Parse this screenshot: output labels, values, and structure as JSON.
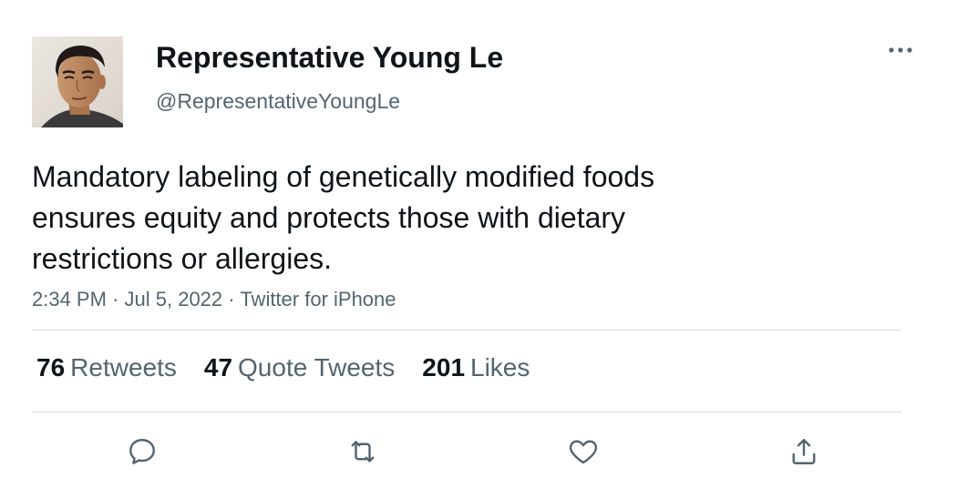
{
  "user": {
    "display_name": "Representative Young Le",
    "handle": "@RepresentativeYoungLe"
  },
  "tweet": {
    "text": "Mandatory labeling of genetically modified foods ensures equity and protects those with dietary restrictions or allergies.",
    "time": "2:34 PM",
    "date": "Jul 5, 2022",
    "source": "Twitter for iPhone"
  },
  "stats": {
    "retweets": {
      "count": "76",
      "label": "Retweets"
    },
    "quotes": {
      "count": "47",
      "label": "Quote Tweets"
    },
    "likes": {
      "count": "201",
      "label": "Likes"
    }
  },
  "icons": {
    "more": "more-horizontal-icon",
    "reply": "reply-icon",
    "retweet": "retweet-icon",
    "like": "heart-icon",
    "share": "share-icon"
  },
  "colors": {
    "text_primary": "#0f1419",
    "text_secondary": "#536471",
    "divider": "#cfd9de"
  }
}
